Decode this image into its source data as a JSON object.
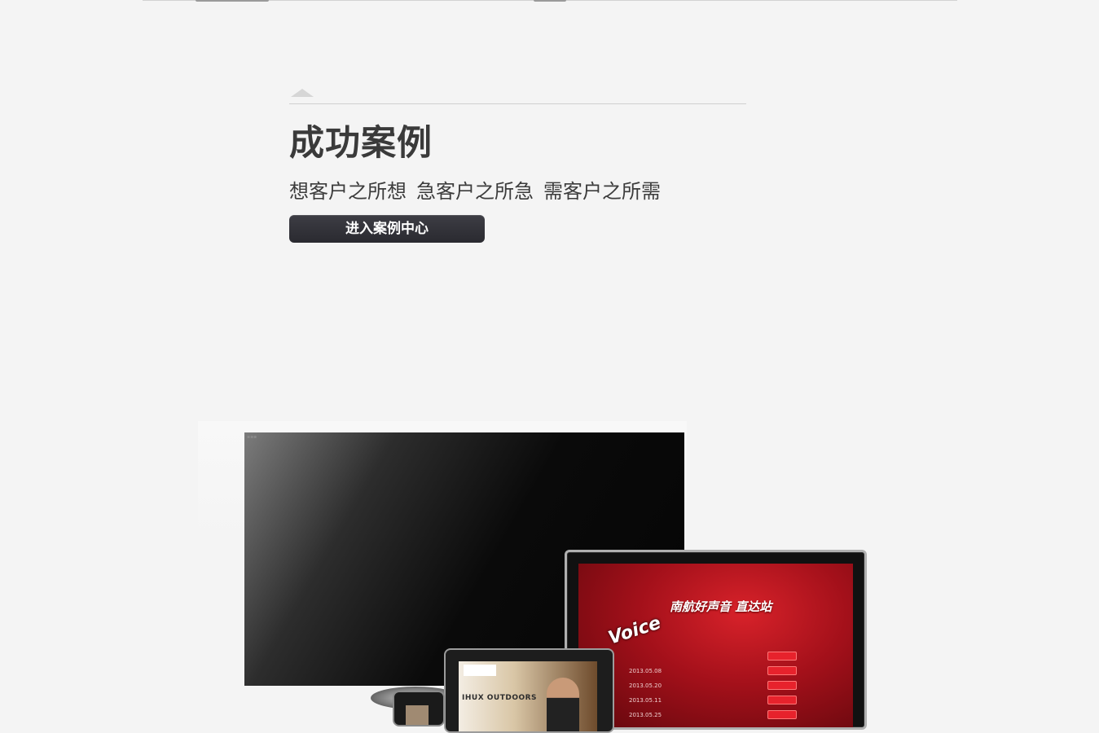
{
  "section": {
    "title": "成功案例",
    "subtitles": [
      "想客户之所想",
      "急客户之所急",
      "需客户之所需"
    ],
    "cta_label": "进入案例中心"
  },
  "showcase": {
    "monitor": {
      "logo_text": "Voice",
      "banner_text": "南航好声音 直达站",
      "dates": [
        "2013.05.08",
        "2013.05.20",
        "2013.05.11",
        "2013.05.25"
      ]
    },
    "tablet": {
      "promo_text": "IHUX OUTDOORS"
    }
  },
  "colors": {
    "background": "#f4f4f4",
    "title_text": "#3a3a3a",
    "cta_background": "#333339",
    "cta_text": "#ffffff",
    "monitor_accent": "#d8222a"
  }
}
